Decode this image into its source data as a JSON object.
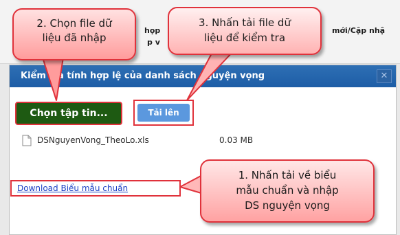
{
  "background_page": {
    "left_text_line1": "họp",
    "left_text_line2": "p v",
    "right_text": "mới/Cập nhậ"
  },
  "dialog": {
    "title": "Kiểm tra tính hợp lệ của danh sách nguyện vọng",
    "close_icon": "close-icon"
  },
  "buttons": {
    "choose_file": "Chọn tập tin...",
    "upload": "Tải lên"
  },
  "file": {
    "icon": "document-icon",
    "name": "DSNguyenVong_TheoLo.xls",
    "size": "0.03 MB"
  },
  "download": {
    "link_text": "Download Biểu mẫu chuẩn"
  },
  "callouts": {
    "choose": {
      "line1": "2. Chọn file dữ",
      "line2": "liệu đã nhập"
    },
    "upload": {
      "line1": "3. Nhấn tải file dữ",
      "line2": "liệu để kiểm tra"
    },
    "download": {
      "line1": "1. Nhấn tải về biểu",
      "line2": "mẫu chuẩn và nhập",
      "line3": "DS nguyện vọng"
    }
  },
  "colors": {
    "title_bar": "#1d5da6",
    "choose_button": "#1e5a12",
    "upload_button": "#5b98de",
    "highlight_border": "#e0323b",
    "callout_fill": "#ff9c9c",
    "link": "#1a3fc4"
  }
}
